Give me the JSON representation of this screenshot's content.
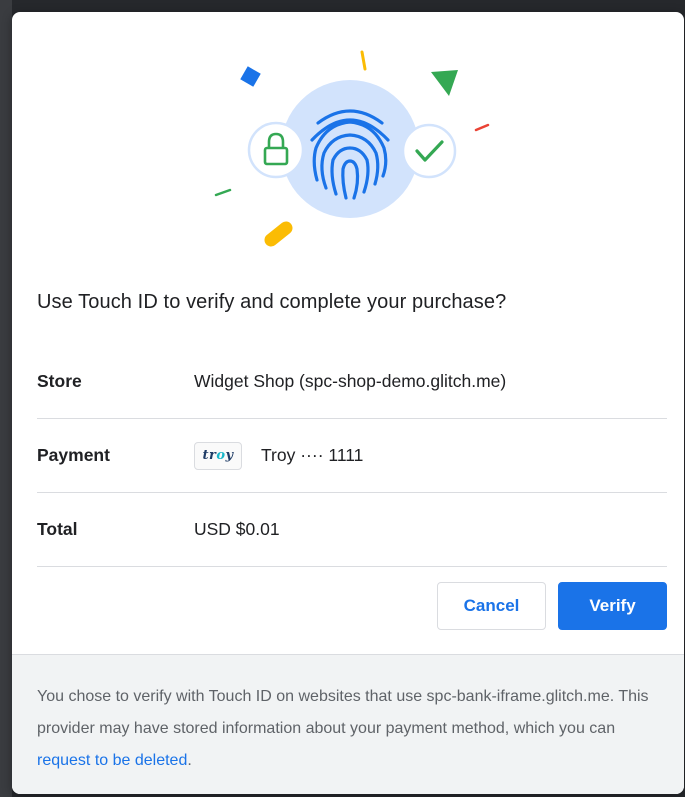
{
  "dialog": {
    "prompt": "Use Touch ID to verify and complete your purchase?",
    "rows": [
      {
        "label": "Store",
        "value": "Widget Shop (spc-shop-demo.glitch.me)"
      },
      {
        "label": "Payment",
        "value": "Troy ···· 1111",
        "card_logo": "troy"
      },
      {
        "label": "Total",
        "value": "USD $0.01"
      }
    ],
    "buttons": {
      "cancel": "Cancel",
      "verify": "Verify"
    },
    "footer": {
      "text_before": "You chose to verify with Touch ID on websites that use spc-bank-iframe.glitch.me. This provider may have stored information about your payment method, which you can ",
      "link": "request to be deleted",
      "text_after": "."
    }
  },
  "icons": {
    "center": "fingerprint-icon",
    "left": "lock-icon",
    "right": "checkmark-icon"
  },
  "colors": {
    "accent": "#1a73e8",
    "green": "#34a853",
    "yellow": "#fbbc04",
    "red": "#ea4335",
    "circle": "#d2e3fc"
  }
}
